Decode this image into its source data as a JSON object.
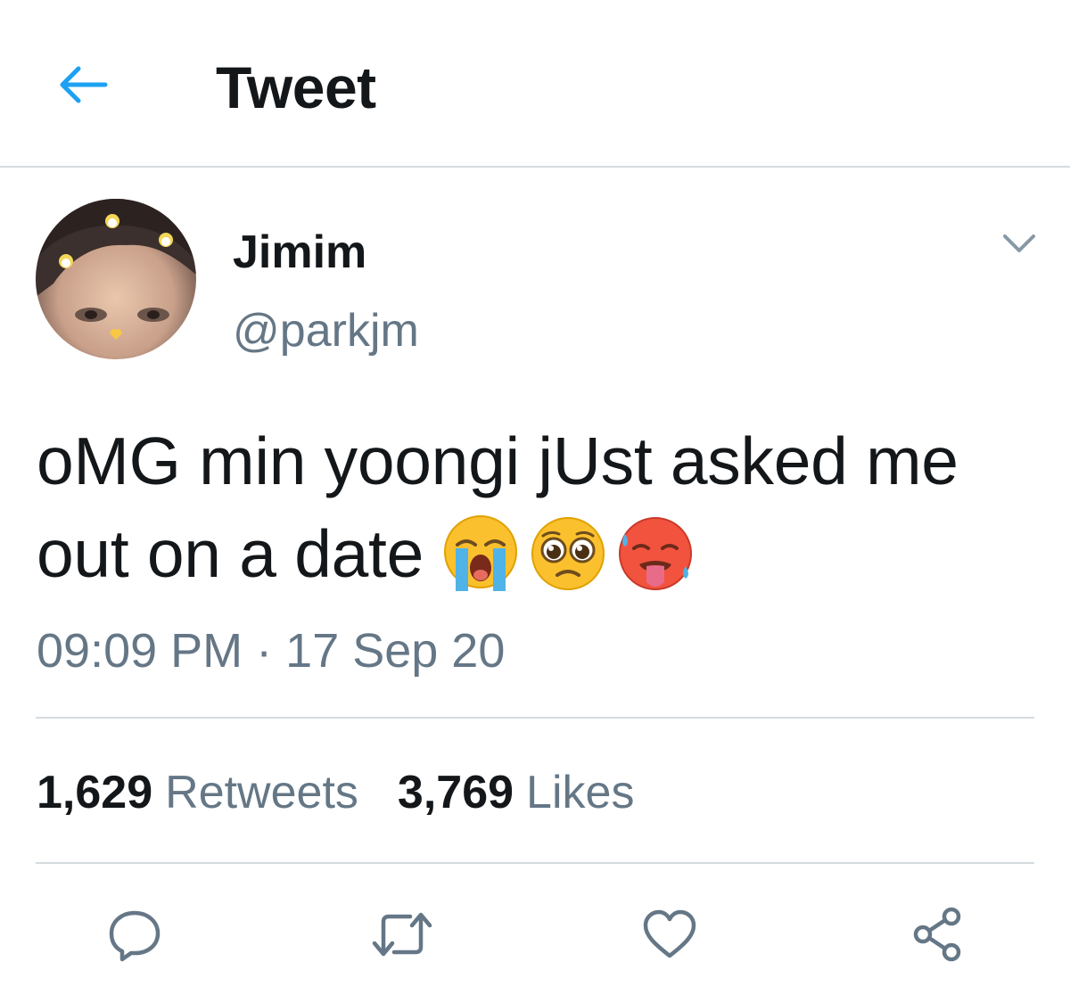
{
  "header": {
    "title": "Tweet",
    "back_icon": "arrow-left-icon",
    "accent_color": "#1da1f2"
  },
  "author": {
    "name": "Jimim",
    "handle": "@parkjm",
    "menu_icon": "chevron-down-icon"
  },
  "tweet": {
    "text": "oMG min yoongi jUst asked me out on a date",
    "emojis": [
      "loudly-crying-face",
      "pleading-face",
      "hot-face"
    ],
    "time": "09:09 PM",
    "separator": "·",
    "date": "17 Sep 20"
  },
  "stats": {
    "retweets_count": "1,629",
    "retweets_label": "Retweets",
    "likes_count": "3,769",
    "likes_label": "Likes"
  },
  "actions": [
    "reply-icon",
    "retweet-icon",
    "like-icon",
    "share-icon"
  ],
  "colors": {
    "text": "#14171a",
    "secondary": "#657786",
    "divider": "#d6dbdf"
  }
}
